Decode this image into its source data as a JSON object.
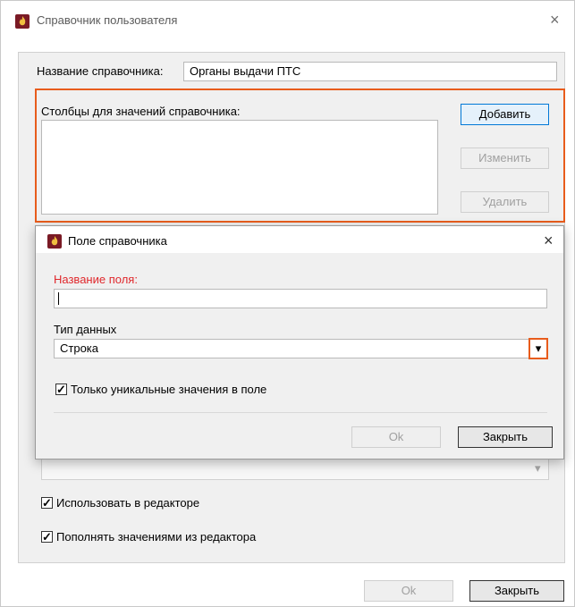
{
  "window": {
    "title": "Справочник пользователя",
    "close_glyph": "×",
    "icon": "app-flame-icon"
  },
  "main": {
    "name_label": "Название справочника:",
    "name_value": "Органы выдачи ПТС",
    "columns_label": "Столбцы для значений справочника:",
    "add_button": "Добавить",
    "edit_button": "Изменить",
    "delete_button": "Удалить",
    "use_in_editor": "Использовать в редакторе",
    "fill_from_editor": "Пополнять значениями из редактора",
    "dropdown_arrow": "▾"
  },
  "footer": {
    "ok_button": "Ok",
    "close_button": "Закрыть"
  },
  "dialog": {
    "title": "Поле справочника",
    "close_glyph": "×",
    "field_name_label": "Название поля:",
    "field_name_value": "",
    "data_type_label": "Тип данных",
    "data_type_value": "Строка",
    "dropdown_arrow": "▾",
    "unique_label": "Только уникальные значения в поле",
    "ok_button": "Ok",
    "close_button": "Закрыть"
  },
  "colors": {
    "highlight": "#e85c1c",
    "error_label": "#e0282c",
    "primary_border": "#0078d7"
  }
}
